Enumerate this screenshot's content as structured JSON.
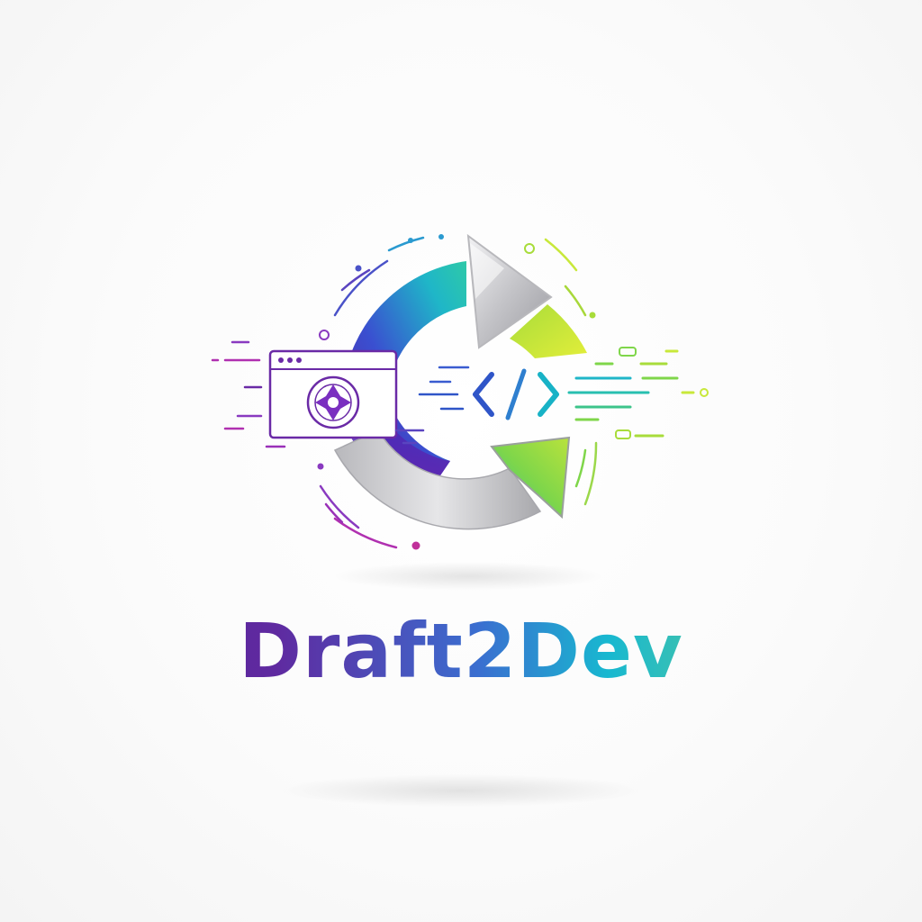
{
  "brand": {
    "name": "Draft2Dev",
    "colors": {
      "purple": "#5b1f98",
      "violet": "#7a2fc0",
      "blue": "#3a5cd0",
      "teal": "#18b8c8",
      "green": "#7fd64a",
      "lime": "#c8e83a",
      "silver": "#c9c9cc"
    }
  },
  "logo": {
    "icons": [
      "browser-window-icon",
      "camera-aperture-icon",
      "code-brackets-icon",
      "cycle-arrows-icon"
    ]
  }
}
